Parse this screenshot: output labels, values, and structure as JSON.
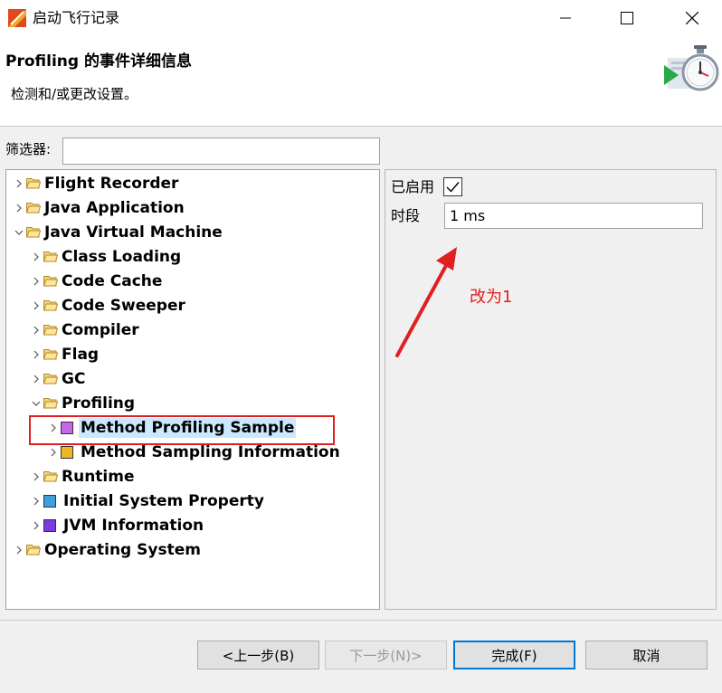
{
  "window": {
    "title": "启动飞行记录"
  },
  "header": {
    "title": "Profiling 的事件详细信息",
    "description": "检测和/或更改设置。"
  },
  "filter": {
    "label": "筛选器:",
    "value": ""
  },
  "tree": [
    {
      "label": "Flight Recorder",
      "icon": "folder-icon",
      "expanded": false
    },
    {
      "label": "Java Application",
      "icon": "folder-icon",
      "expanded": false
    },
    {
      "label": "Java Virtual Machine",
      "icon": "folder-icon",
      "expanded": true
    },
    {
      "label": "Class Loading",
      "icon": "folder-icon",
      "expanded": false
    },
    {
      "label": "Code Cache",
      "icon": "folder-icon",
      "expanded": false
    },
    {
      "label": "Code Sweeper",
      "icon": "folder-icon",
      "expanded": false
    },
    {
      "label": "Compiler",
      "icon": "folder-icon",
      "expanded": false
    },
    {
      "label": "Flag",
      "icon": "folder-icon",
      "expanded": false
    },
    {
      "label": "GC",
      "icon": "folder-icon",
      "expanded": false
    },
    {
      "label": "Profiling",
      "icon": "folder-icon",
      "expanded": true
    },
    {
      "label": "Method Profiling Sample",
      "icon": "event-type-icon",
      "color": "#c864e6",
      "selected": true
    },
    {
      "label": "Method Sampling Information",
      "icon": "event-type-icon",
      "color": "#f0b428"
    },
    {
      "label": "Runtime",
      "icon": "folder-icon",
      "expanded": false
    },
    {
      "label": "Initial System Property",
      "icon": "event-type-icon",
      "color": "#3ca0dc"
    },
    {
      "label": "JVM Information",
      "icon": "event-type-icon",
      "color": "#7a3ce0"
    },
    {
      "label": "Operating System",
      "icon": "folder-icon",
      "expanded": false
    }
  ],
  "settings": {
    "enabled_label": "已启用",
    "enabled": true,
    "period_label": "时段",
    "period_value": "1 ms"
  },
  "annotation": {
    "text": "改为1",
    "color": "#e02020"
  },
  "buttons": {
    "back": "<上一步(B)",
    "next": "下一步(N)>",
    "finish": "完成(F)",
    "cancel": "取消"
  }
}
